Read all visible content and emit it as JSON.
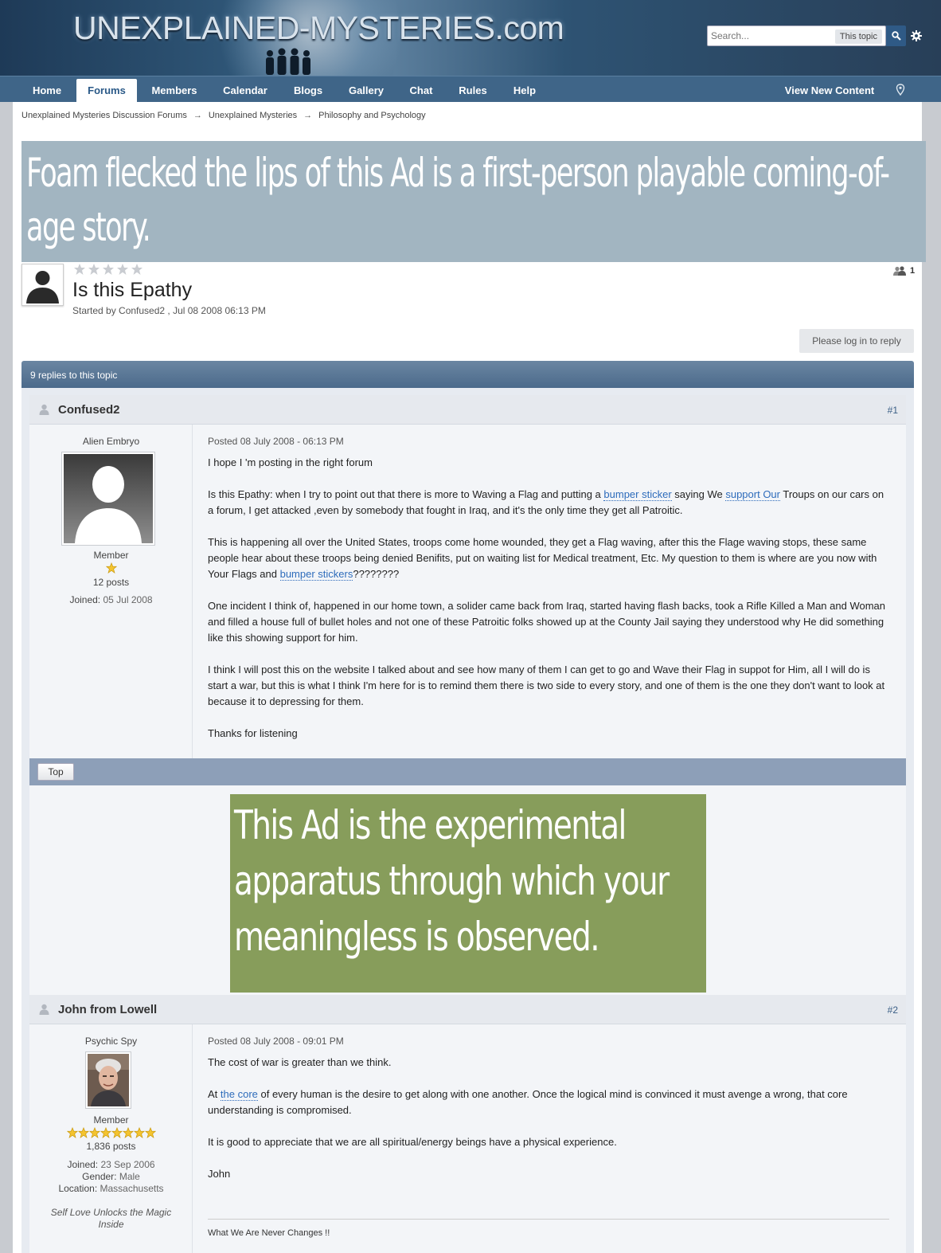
{
  "header": {
    "logo": "UNEXPLAINED-MYSTERIES.com",
    "search_placeholder": "Search...",
    "search_scope": "This topic"
  },
  "nav": {
    "tabs": [
      "Home",
      "Forums",
      "Members",
      "Calendar",
      "Blogs",
      "Gallery",
      "Chat",
      "Rules",
      "Help"
    ],
    "active": "Forums",
    "view_new": "View New Content"
  },
  "breadcrumb": [
    "Unexplained Mysteries Discussion Forums",
    "Unexplained Mysteries",
    "Philosophy and Psychology"
  ],
  "breadcrumb_sep": "→",
  "ads": {
    "top": "Foam flecked the lips of this Ad is a first-person playable coming-of-age story.",
    "middle": "This Ad is the experimental apparatus through which your meaningless is observed."
  },
  "topic": {
    "title": "Is this Epathy",
    "meta": "Started by Confused2 , Jul 08 2008 06:13 PM",
    "viewers": "1",
    "reply_button": "Please log in to reply",
    "replies_bar": "9 replies to this topic"
  },
  "posts": [
    {
      "author": "Confused2",
      "number": "#1",
      "rank_title": "Alien Embryo",
      "group": "Member",
      "posts_count": "12 posts",
      "joined_label": "Joined:",
      "joined": "05 Jul 2008",
      "posted": "Posted 08 July 2008 - 06:13 PM",
      "p1": "I hope I 'm posting in the right forum",
      "p2_a": "Is this Epathy: when I try to point out that there is more to Waving a Flag and putting a ",
      "p2_link1": "bumper sticker",
      "p2_b": " saying We ",
      "p2_link2": "support Our",
      "p2_c": " Troups on our cars on a forum, I get attacked ,even by somebody that fought in Iraq, and it's the only time they get all Patroitic.",
      "p3_a": "This is happening all over the United States, troops come home wounded, they get a Flag waving, after this the Flage waving stops, these same people hear about these troops being denied Benifits, put on waiting list for Medical treatment, Etc. My question to them is where are you now with Your Flags and ",
      "p3_link": "bumper stickers",
      "p3_b": "????????",
      "p4": "One incident I think of, happened in our home town, a solider came back from Iraq, started having flash backs, took a Rifle Killed a Man and Woman and filled a house full of bullet holes and not one of these Patroitic folks showed up at the County Jail saying they understood why He did something like this showing support for him.",
      "p5": "I think I will post this on the website I talked about and see how many of them I can get to go and Wave their Flag in suppot for Him, all I will do is start a war, but this is what I think I'm here for is to remind them there is two side to every story, and one of them is the one they don't want to look at because it to depressing for them.",
      "p6": "Thanks for listening",
      "top_button": "Top"
    },
    {
      "author": "John from Lowell",
      "number": "#2",
      "rank_title": "Psychic Spy",
      "group": "Member",
      "posts_count": "1,836 posts",
      "joined_label": "Joined:",
      "joined": "23 Sep 2006",
      "gender_label": "Gender:",
      "gender": "Male",
      "location_label": "Location:",
      "location": "Massachusetts",
      "quote": "Self Love Unlocks the Magic Inside",
      "posted": "Posted 08 July 2008 - 09:01 PM",
      "p1": "The cost of war is greater than we think.",
      "p2_a": "At ",
      "p2_link": "the core",
      "p2_b": " of every human is the desire to get along with one another. Once the logical mind is convinced it must avenge a wrong, that core understanding is compromised.",
      "p3": "It is good to appreciate that we are all spiritual/energy beings have a physical experience.",
      "p4": "John",
      "signature": "What We Are Never Changes !!"
    }
  ]
}
